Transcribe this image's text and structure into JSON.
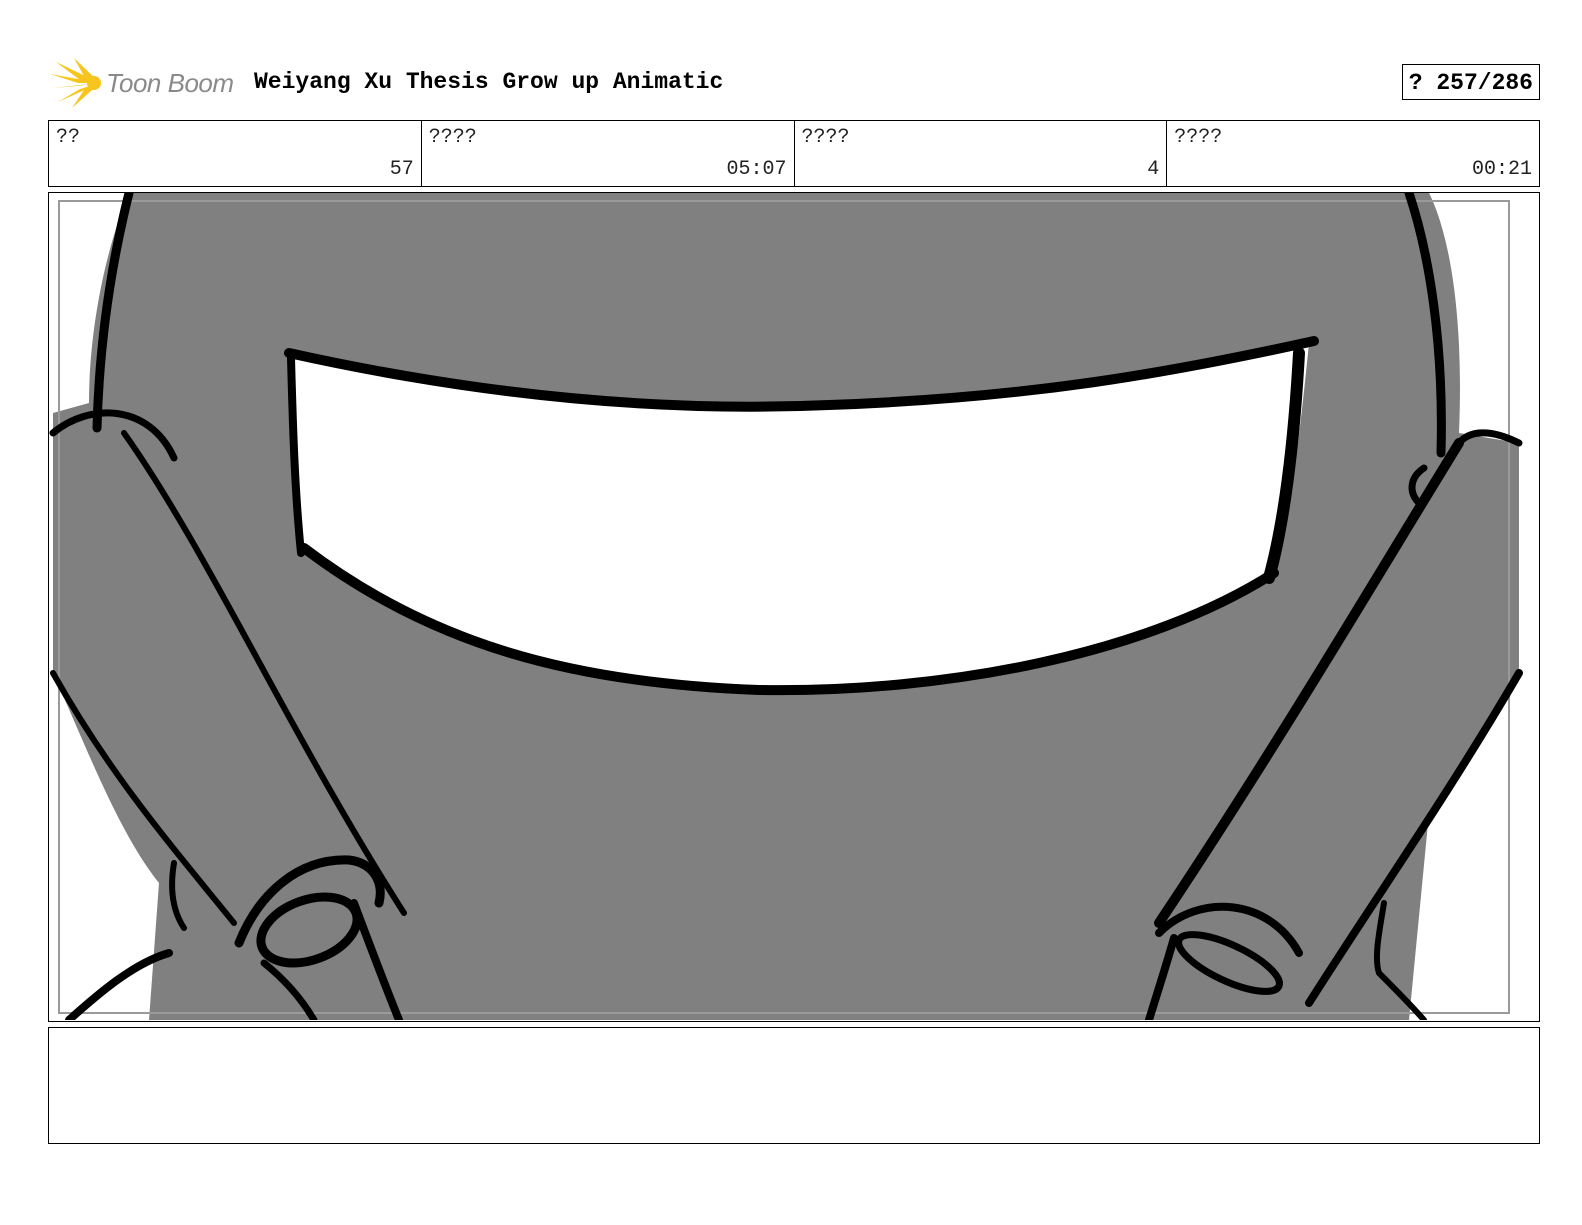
{
  "header": {
    "logo_text": "Toon Boom",
    "project_title": "Weiyang Xu Thesis Grow up Animatic",
    "page_indicator": "? 257/286",
    "logo_color": "#f7c51e"
  },
  "info_cells": [
    {
      "label": "??",
      "value": "57"
    },
    {
      "label": "????",
      "value": "05:07"
    },
    {
      "label": "????",
      "value": "4"
    },
    {
      "label": "????",
      "value": "00:21"
    }
  ],
  "panel": {
    "image_icon": "storyboard-sketch-image",
    "fill_color": "#808080",
    "line_color": "#000000"
  },
  "notes": {
    "text": ""
  }
}
